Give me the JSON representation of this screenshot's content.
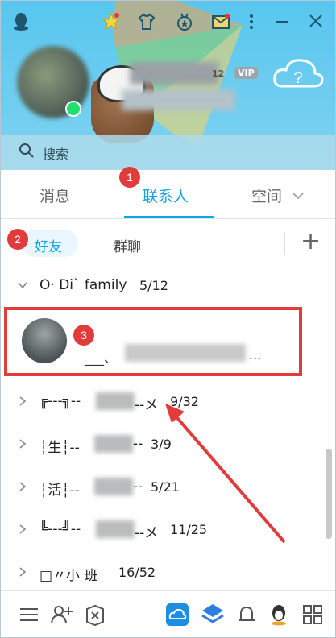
{
  "titlebar": {
    "icons": [
      "qq-logo-icon",
      "star-level-icon",
      "shirt-icon",
      "medal-icon",
      "mail-icon",
      "more-icon",
      "minimize-icon",
      "close-icon"
    ],
    "level": "12",
    "vip": "VIP"
  },
  "search": {
    "placeholder": "搜索"
  },
  "tabs": [
    {
      "label": "消息"
    },
    {
      "label": "联系人"
    },
    {
      "label": "空间"
    }
  ],
  "subtabs": {
    "friends": "好友",
    "groups": "群聊",
    "add": "+"
  },
  "annotations": [
    "1",
    "2",
    "3"
  ],
  "groups": [
    {
      "name": "O· Di` family",
      "count": "5/12"
    },
    {
      "name": "╔---╗--",
      "suffix": "--メ",
      "count": "9/32"
    },
    {
      "name": "┆生┆--",
      "suffix": "--",
      "count": "3/9"
    },
    {
      "name": "┆活┆--",
      "suffix": "--",
      "count": "5/21"
    },
    {
      "name": "╚---╝--",
      "suffix": "--メ",
      "count": "11/25"
    },
    {
      "name": "□〃小 班",
      "count": "16/52"
    }
  ],
  "contact": {
    "name": "___、",
    "ellipsis": "..."
  },
  "colors": {
    "accent": "#12a3e3",
    "annotation": "#e13b3b"
  }
}
